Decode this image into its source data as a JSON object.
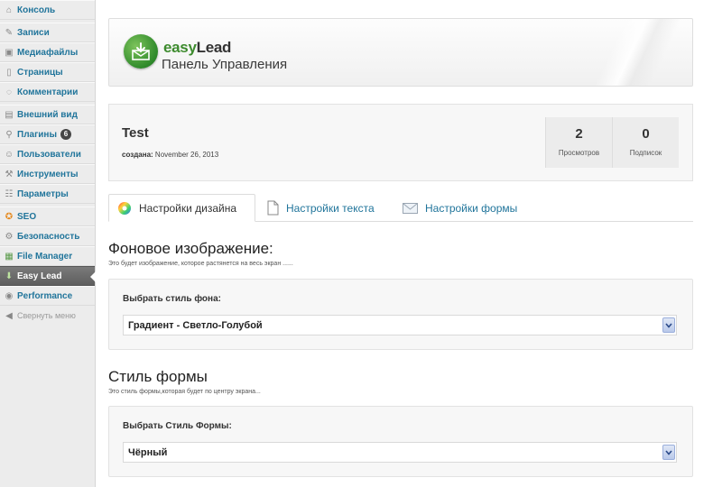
{
  "sidebar": {
    "items": [
      {
        "icon": "home-icon",
        "label": "Консоль"
      },
      {
        "icon": "pin-icon",
        "label": "Записи"
      },
      {
        "icon": "media-icon",
        "label": "Медиафайлы"
      },
      {
        "icon": "pages-icon",
        "label": "Страницы"
      },
      {
        "icon": "comments-icon",
        "label": "Комментарии"
      },
      {
        "icon": "appearance-icon",
        "label": "Внешний вид"
      },
      {
        "icon": "plugins-icon",
        "label": "Плагины",
        "badge": "6"
      },
      {
        "icon": "users-icon",
        "label": "Пользователи"
      },
      {
        "icon": "tools-icon",
        "label": "Инструменты"
      },
      {
        "icon": "settings-icon",
        "label": "Параметры"
      },
      {
        "icon": "seo-icon",
        "label": "SEO"
      },
      {
        "icon": "security-icon",
        "label": "Безопасность"
      },
      {
        "icon": "file-manager-icon",
        "label": "File Manager"
      },
      {
        "icon": "easy-lead-icon",
        "label": "Easy Lead"
      },
      {
        "icon": "performance-icon",
        "label": "Performance"
      }
    ],
    "collapse_label": "Свернуть меню"
  },
  "header": {
    "brand_easy": "easy",
    "brand_lead": "Lead",
    "subtitle": "Панель Управления"
  },
  "campaign": {
    "name": "Test",
    "created_label": "создана:",
    "created_date": "November 26, 2013",
    "views_value": "2",
    "views_label": "Просмотров",
    "subs_value": "0",
    "subs_label": "Подписок"
  },
  "tabs": [
    {
      "label": "Настройки дизайна"
    },
    {
      "label": "Настройки текста"
    },
    {
      "label": "Настройки формы"
    }
  ],
  "background_section": {
    "title": "Фоновое изображение:",
    "description": "Это будет изображение, которое растянется на весь экран ......",
    "field_label": "Выбрать стиль фона:",
    "selected": "Градиент - Светло-Голубой"
  },
  "form_style_section": {
    "title": "Стиль формы",
    "description": "Это стиль формы,которая будет по центру экрана...",
    "field_label": "Выбрать Стиль Формы:",
    "selected": "Чёрный"
  },
  "colors": {
    "link": "#21759b",
    "brand_green": "#3d8b2e",
    "active_menu": "#6b6b6b"
  }
}
